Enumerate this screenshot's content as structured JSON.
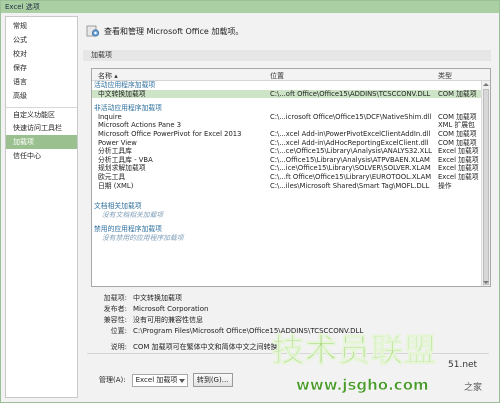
{
  "window": {
    "title": "Excel 选项"
  },
  "sidebar": {
    "items": [
      {
        "label": "常规"
      },
      {
        "label": "公式"
      },
      {
        "label": "校对"
      },
      {
        "label": "保存"
      },
      {
        "label": "语言"
      },
      {
        "label": "高级"
      },
      {
        "label": "自定义功能区"
      },
      {
        "label": "快速访问工具栏"
      },
      {
        "label": "加载项"
      },
      {
        "label": "信任中心"
      }
    ],
    "active_index": 8
  },
  "main": {
    "header_text": "查看和管理 Microsoft Office 加载项。",
    "header_icon": "addin-gear-icon",
    "section_label": "加载项",
    "columns": {
      "name": "名称 ▴",
      "location": "位置",
      "type": "类型"
    },
    "groups": [
      {
        "title": "活动应用程序加载项",
        "rows": [
          {
            "name": "中文转换加载项",
            "location": "C:\\...oft Office\\Office15\\ADDINS\\TCSCCONV.DLL",
            "type": "COM 加载项",
            "selected": true
          }
        ]
      },
      {
        "title": "非活动应用程序加载项",
        "rows": [
          {
            "name": "Inquire",
            "location": "C:\\...icrosoft Office\\Office15\\DCF\\NativeShim.dll",
            "type": "COM 加载项"
          },
          {
            "name": "Microsoft Actions Pane 3",
            "location": "",
            "type": "XML 扩展包"
          },
          {
            "name": "Microsoft Office PowerPivot for Excel 2013",
            "location": "C:\\...xcel Add-in\\PowerPivotExcelClientAddIn.dll",
            "type": "COM 加载项"
          },
          {
            "name": "Power View",
            "location": "C:\\...xcel Add-in\\AdHocReportingExcelClient.dll",
            "type": "COM 加载项"
          },
          {
            "name": "分析工具库",
            "location": "C:\\...ce\\Office15\\Library\\Analysis\\ANALYS32.XLL",
            "type": "Excel 加载项"
          },
          {
            "name": "分析工具库 - VBA",
            "location": "C:\\...Office15\\Library\\Analysis\\ATPVBAEN.XLAM",
            "type": "Excel 加载项"
          },
          {
            "name": "规划求解加载项",
            "location": "C:\\...ice\\Office15\\Library\\SOLVER\\SOLVER.XLAM",
            "type": "Excel 加载项"
          },
          {
            "name": "欧元工具",
            "location": "C:\\...ft Office\\Office15\\Library\\EUROTOOL.XLAM",
            "type": "Excel 加载项"
          },
          {
            "name": "日期 (XML)",
            "location": "C:\\...iles\\Microsoft Shared\\Smart Tag\\MOFL.DLL",
            "type": "操作"
          }
        ]
      },
      {
        "title": "文档相关加载项",
        "empty_text": "没有文档相关加载项",
        "rows": []
      },
      {
        "title": "禁用的应用程序加载项",
        "empty_text": "没有禁用的应用程序加载项",
        "rows": []
      }
    ],
    "details": {
      "addin_label": "加载项:",
      "addin_value": "中文转换加载项",
      "publisher_label": "发布者:",
      "publisher_value": "Microsoft Corporation",
      "compat_label": "兼容性:",
      "compat_value": "没有可用的兼容性信息",
      "location_label": "位置:",
      "location_value": "C:\\Program Files\\Microsoft Office\\Office15\\ADDINS\\TCSCCONV.DLL",
      "desc_label": "说明:",
      "desc_value": "COM 加载项可在繁体中文和简体中文之间转换。"
    },
    "manage": {
      "label": "管理(A):",
      "selected": "Excel 加载项",
      "goto_label": "转到(G)..."
    }
  },
  "watermark": {
    "text": "技术员联盟",
    "url": "www.jsgho.com",
    "side1": "51.net",
    "side2": "之家"
  }
}
